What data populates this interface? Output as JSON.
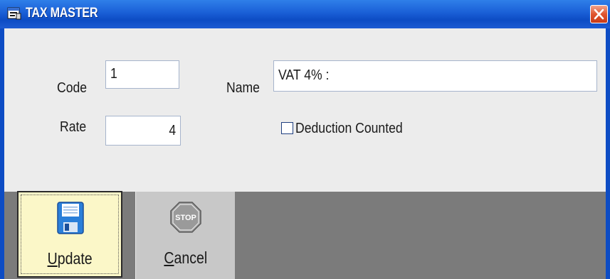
{
  "window": {
    "title": "TAX MASTER"
  },
  "form": {
    "code_label": "Code",
    "code_value": "1",
    "name_label": "Name",
    "name_value": "VAT 4% :",
    "rate_label": "Rate",
    "rate_value": "4",
    "deduction_label": "Deduction Counted",
    "deduction_checked": false
  },
  "toolbar": {
    "update_label": "Update",
    "cancel_label": "Cancel",
    "stop_sign_text": "STOP"
  },
  "icons": {
    "window_icon": "app-window-icon",
    "close": "close-icon",
    "update": "floppy-disk-icon",
    "cancel": "stop-sign-icon"
  },
  "colors": {
    "titlebar": "#0d4cc4",
    "close_button": "#e0552f",
    "client_background": "#ececec",
    "toolbar_background": "#7b7b7b",
    "update_button": "#fbf7c8",
    "cancel_button": "#c8c8c8",
    "stop_sign": "#9a9a9a",
    "floppy": "#2a7fd9"
  }
}
